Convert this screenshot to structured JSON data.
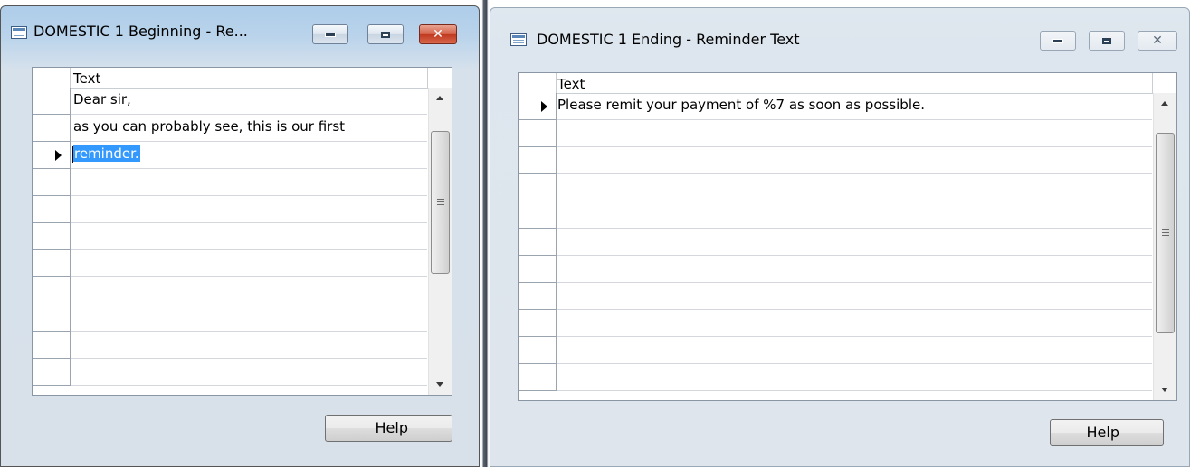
{
  "windows": [
    {
      "title": "DOMESTIC 1 Beginning - Re...",
      "state": "active",
      "column_header": "Text",
      "rows": [
        {
          "text": "Dear sir,",
          "current": false,
          "selected": false
        },
        {
          "text": "as you can probably see, this is our first",
          "current": false,
          "selected": false
        },
        {
          "text": "reminder.",
          "current": true,
          "selected": true
        },
        {
          "text": "",
          "current": false,
          "selected": false
        },
        {
          "text": "",
          "current": false,
          "selected": false
        },
        {
          "text": "",
          "current": false,
          "selected": false
        },
        {
          "text": "",
          "current": false,
          "selected": false
        },
        {
          "text": "",
          "current": false,
          "selected": false
        },
        {
          "text": "",
          "current": false,
          "selected": false
        },
        {
          "text": "",
          "current": false,
          "selected": false
        },
        {
          "text": "",
          "current": false,
          "selected": false
        }
      ],
      "help_label": "Help"
    },
    {
      "title": "DOMESTIC 1 Ending - Reminder Text",
      "state": "inactive",
      "column_header": "Text",
      "rows": [
        {
          "text": "Please remit your payment of %7 as soon as possible.",
          "current": true,
          "selected": false
        },
        {
          "text": "",
          "current": false,
          "selected": false
        },
        {
          "text": "",
          "current": false,
          "selected": false
        },
        {
          "text": "",
          "current": false,
          "selected": false
        },
        {
          "text": "",
          "current": false,
          "selected": false
        },
        {
          "text": "",
          "current": false,
          "selected": false
        },
        {
          "text": "",
          "current": false,
          "selected": false
        },
        {
          "text": "",
          "current": false,
          "selected": false
        },
        {
          "text": "",
          "current": false,
          "selected": false
        },
        {
          "text": "",
          "current": false,
          "selected": false
        },
        {
          "text": "",
          "current": false,
          "selected": false
        }
      ],
      "help_label": "Help"
    }
  ],
  "icons": [
    "table-icon",
    "minimize-icon",
    "maximize-icon",
    "close-icon",
    "row-pointer-icon",
    "scroll-up-icon",
    "scroll-down-icon"
  ],
  "colors": {
    "selection": "#3399ff",
    "close_button_active": "#c0391f"
  }
}
